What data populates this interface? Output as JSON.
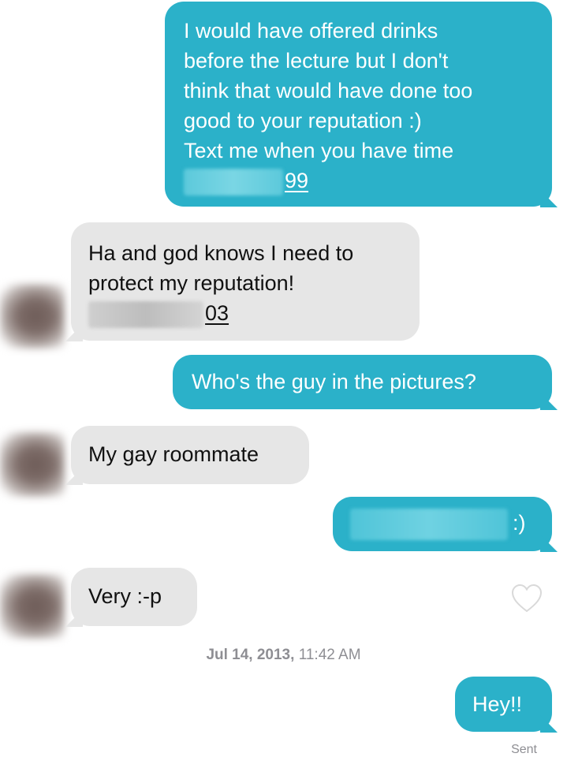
{
  "messages": {
    "m1": {
      "direction": "outgoing",
      "lines": [
        "I would have offered drinks",
        "before the lecture but I don't",
        "think that would have done too",
        "good to your reputation :)",
        "Text me when you have time"
      ],
      "phone_visible_suffix": "99"
    },
    "m2": {
      "direction": "incoming",
      "lines": [
        "Ha and god knows I need to",
        "protect my reputation!"
      ],
      "phone_visible_suffix": "03"
    },
    "m3": {
      "direction": "outgoing",
      "text": "Who's the guy in the pictures?"
    },
    "m4": {
      "direction": "incoming",
      "text": "My gay roommate"
    },
    "m5": {
      "direction": "outgoing",
      "visible_suffix": ":)"
    },
    "m6": {
      "direction": "incoming",
      "text": "Very :-p"
    },
    "m7": {
      "direction": "outgoing",
      "text": "Hey!!"
    }
  },
  "timestamp": {
    "date": "Jul 14, 2013,",
    "time": "11:42 AM"
  },
  "delivery_status": "Sent",
  "colors": {
    "outgoing_bubble": "#2bb1c9",
    "incoming_bubble": "#e6e6e6",
    "meta_text": "#8e8e93"
  },
  "icons": {
    "like": "heart-outline-icon",
    "avatar": "blurred-avatar"
  }
}
